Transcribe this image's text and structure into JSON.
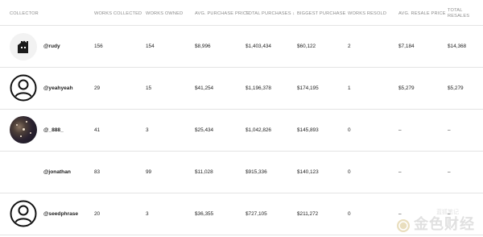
{
  "headers": {
    "collector": "COLLECTOR",
    "works_collected": "WORKS COLLECTED",
    "works_owned": "WORKS OWNED",
    "avg_purchase": "AVG. PURCHASE PRICE",
    "total_purchases": "TOTAL PURCHASES ↓",
    "biggest_purchase": "BIGGEST PURCHASE",
    "works_resold": "WORKS RESOLD",
    "avg_resale": "AVG. RESALE PRICE",
    "total_resales_1": "TOTAL",
    "total_resales_2": "RESALES"
  },
  "rows": [
    {
      "name": "@rudy",
      "avatar": "house-icon",
      "collected": "156",
      "owned": "154",
      "avg": "$8,996",
      "total": "$1,403,434",
      "biggest": "$60,122",
      "resold": "2",
      "avg_resale": "$7,184",
      "total_resales": "$14,368"
    },
    {
      "name": "@yeahyeah",
      "avatar": "user-icon",
      "collected": "29",
      "owned": "15",
      "avg": "$41,254",
      "total": "$1,196,378",
      "biggest": "$174,195",
      "resold": "1",
      "avg_resale": "$5,279",
      "total_resales": "$5,279"
    },
    {
      "name": "@_888_",
      "avatar": "space-image",
      "collected": "41",
      "owned": "3",
      "avg": "$25,434",
      "total": "$1,042,826",
      "biggest": "$145,893",
      "resold": "0",
      "avg_resale": "–",
      "total_resales": "–"
    },
    {
      "name": "@jonathan",
      "avatar": "none",
      "collected": "83",
      "owned": "99",
      "avg": "$11,028",
      "total": "$915,336",
      "biggest": "$140,123",
      "resold": "0",
      "avg_resale": "–",
      "total_resales": "–"
    },
    {
      "name": "@seedphrase",
      "avatar": "user-icon",
      "collected": "20",
      "owned": "3",
      "avg": "$36,355",
      "total": "$727,105",
      "biggest": "$211,272",
      "resold": "0",
      "avg_resale": "–",
      "total_resales": "–"
    }
  ],
  "watermark": {
    "text": "金色财经",
    "small": "蓝狐笔记"
  }
}
